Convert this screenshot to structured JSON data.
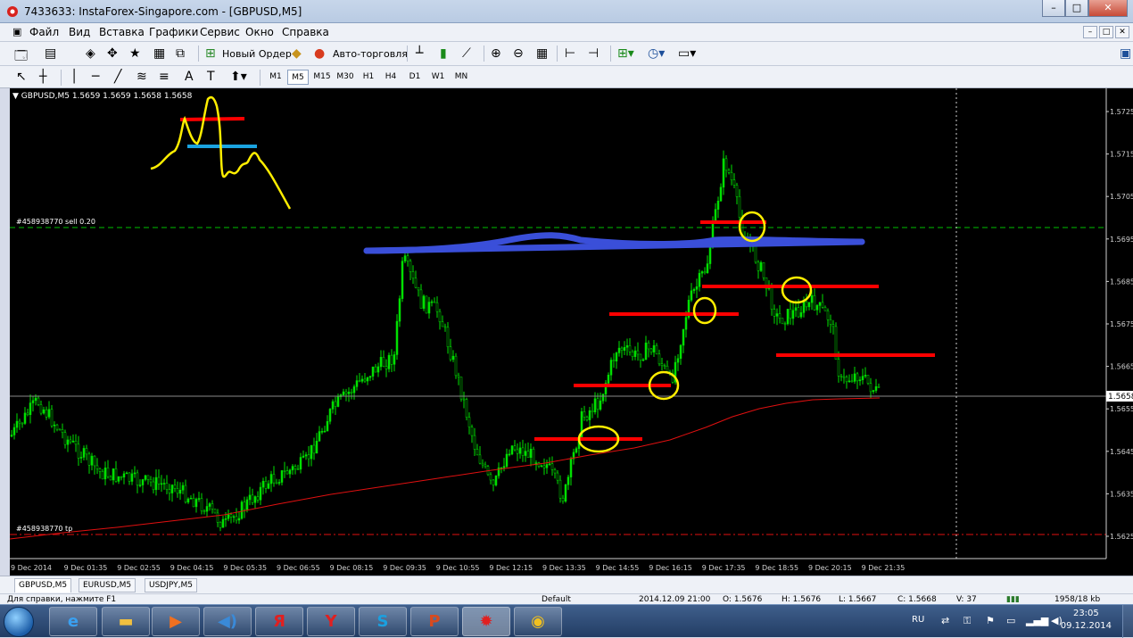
{
  "window": {
    "title": "7433633: InstaForex-Singapore.com - [GBPUSD,M5]",
    "min": "–",
    "max": "□",
    "close": "✕"
  },
  "menu": [
    "Файл",
    "Вид",
    "Вставка",
    "Графики",
    "Сервис",
    "Окно",
    "Справка"
  ],
  "mdi": [
    "–",
    "□",
    "✕"
  ],
  "toolbar": {
    "new_order": "Новый Ордер",
    "auto_trading": "Авто-торговля"
  },
  "timeframes": [
    "M1",
    "M5",
    "M15",
    "M30",
    "H1",
    "H4",
    "D1",
    "W1",
    "MN"
  ],
  "timeframe_active": "M5",
  "chart": {
    "header": "GBPUSD,M5  1.5659 1.5659 1.5658 1.5658",
    "sell_label": "#458938770 sell 0.20",
    "tp_label": "#458938770 tp",
    "current_price": "1.5658",
    "price_labels": [
      "1.5725",
      "1.5715",
      "1.5705",
      "1.5695",
      "1.5685",
      "1.5675",
      "1.5665",
      "1.5655",
      "1.5645",
      "1.5635",
      "1.5625"
    ],
    "time_labels": [
      "9 Dec 2014",
      "9 Dec 01:35",
      "9 Dec 02:55",
      "9 Dec 04:15",
      "9 Dec 05:35",
      "9 Dec 06:55",
      "9 Dec 08:15",
      "9 Dec 09:35",
      "9 Dec 10:55",
      "9 Dec 12:15",
      "9 Dec 13:35",
      "9 Dec 14:55",
      "9 Dec 16:15",
      "9 Dec 17:35",
      "9 Dec 18:55",
      "9 Dec 20:15",
      "9 Dec 21:35"
    ],
    "colors": {
      "bg": "#000000",
      "candles": "#00e000",
      "ma": "#e01010",
      "grid_dash": "#00c000",
      "annot_red": "#ff0000",
      "annot_blue": "#3a4fd9",
      "annot_yellow": "#ffee00"
    }
  },
  "tabs": [
    "GBPUSD,M5",
    "EURUSD,M5",
    "USDJPY,M5"
  ],
  "tab_active": "GBPUSD,M5",
  "status": {
    "help": "Для справки, нажмите F1",
    "profile": "Default",
    "time": "2014.12.09 21:00",
    "open": "O: 1.5676",
    "high": "H: 1.5676",
    "low": "L: 1.5667",
    "close": "C: 1.5668",
    "volume": "V: 37",
    "traffic": "1958/18 kb"
  },
  "taskbar": {
    "lang": "RU",
    "time": "23:05",
    "date": "09.12.2014"
  }
}
